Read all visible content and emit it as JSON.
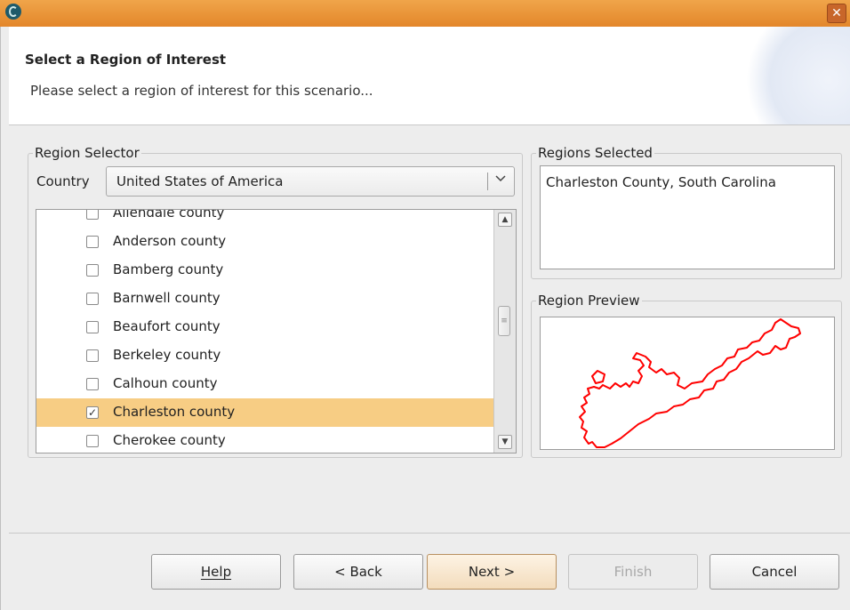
{
  "window": {
    "title": ""
  },
  "header": {
    "title": "Select a Region of Interest",
    "description": "Please select a region of interest for this scenario..."
  },
  "region_selector": {
    "legend": "Region Selector",
    "country_label": "Country",
    "country_value": "United States of America",
    "items": [
      {
        "label": "Allendale county",
        "checked": false
      },
      {
        "label": "Anderson county",
        "checked": false
      },
      {
        "label": "Bamberg county",
        "checked": false
      },
      {
        "label": "Barnwell county",
        "checked": false
      },
      {
        "label": "Beaufort county",
        "checked": false
      },
      {
        "label": "Berkeley county",
        "checked": false
      },
      {
        "label": "Calhoun county",
        "checked": false
      },
      {
        "label": "Charleston county",
        "checked": true
      },
      {
        "label": "Cherokee county",
        "checked": false
      }
    ]
  },
  "regions_selected": {
    "legend": "Regions Selected",
    "items": [
      "Charleston County, South Carolina"
    ]
  },
  "region_preview": {
    "legend": "Region Preview",
    "outline_color": "#ff0000"
  },
  "buttons": {
    "help": "Help",
    "back": "< Back",
    "next": "Next >",
    "finish": "Finish",
    "cancel": "Cancel"
  },
  "colors": {
    "titlebar": "#e3862a",
    "selection": "#f7cd84"
  }
}
